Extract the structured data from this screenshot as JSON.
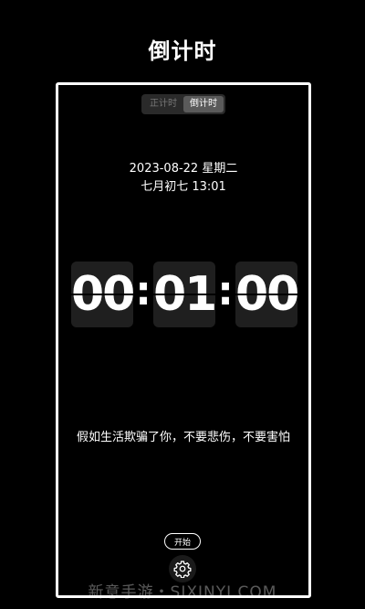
{
  "page": {
    "title": "倒计时"
  },
  "mode_toggle": {
    "tabs": [
      {
        "label": "正计时",
        "active": false
      },
      {
        "label": "倒计时",
        "active": true
      }
    ]
  },
  "date": {
    "gregorian": "2023-08-22   星期二",
    "lunar_time": "七月初七   13:01"
  },
  "clock": {
    "hours": "00",
    "minutes": "01",
    "seconds": "00",
    "separator": ":"
  },
  "quote": "假如生活欺骗了你，不要悲伤，不要害怕",
  "controls": {
    "start_label": "开始",
    "settings_icon": "gear-icon"
  },
  "watermark": "新意手游・SIXINYI.COM"
}
